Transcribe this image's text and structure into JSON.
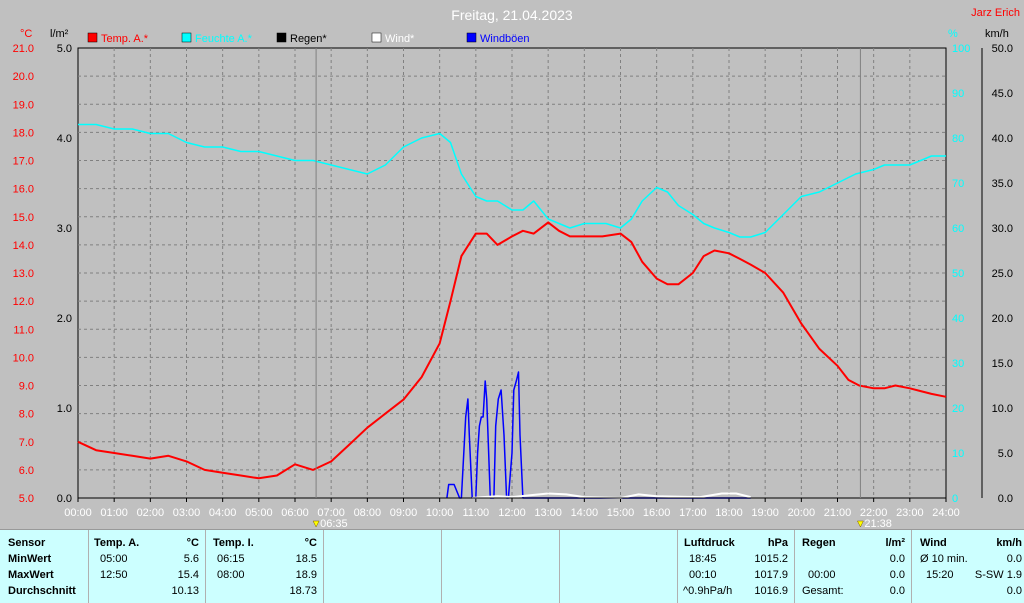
{
  "title": "Freitag, 21.04.2023",
  "author": "Jarz Erich",
  "units": {
    "left_temp": "°C",
    "left_rain": "l/m²",
    "right_hum": "%",
    "right_wind": "km/h"
  },
  "legend": [
    {
      "label": "Temp. A.*",
      "color": "#ff0000"
    },
    {
      "label": "Feuchte A.*",
      "color": "#00ffff"
    },
    {
      "label": "Regen*",
      "color": "#000000"
    },
    {
      "label": "Wind*",
      "color": "#ffffff"
    },
    {
      "label": "Windböen",
      "color": "#0000ff"
    }
  ],
  "sunrise": "06:35",
  "sunset": "21:38",
  "chart_data": {
    "type": "line",
    "title": "Freitag, 21.04.2023",
    "x_ticks": [
      "00:00",
      "01:00",
      "02:00",
      "03:00",
      "04:00",
      "05:00",
      "06:00",
      "07:00",
      "08:00",
      "09:00",
      "10:00",
      "11:00",
      "12:00",
      "13:00",
      "14:00",
      "15:00",
      "16:00",
      "17:00",
      "18:00",
      "19:00",
      "20:00",
      "21:00",
      "22:00",
      "23:00",
      "24:00"
    ],
    "axes": {
      "temp": {
        "ylim": [
          5.0,
          21.0
        ],
        "ticks": [
          "5.0",
          "6.0",
          "7.0",
          "8.0",
          "9.0",
          "10.0",
          "11.0",
          "12.0",
          "13.0",
          "14.0",
          "15.0",
          "16.0",
          "17.0",
          "18.0",
          "19.0",
          "20.0",
          "21.0"
        ]
      },
      "rain": {
        "ylim": [
          0.0,
          5.0
        ],
        "ticks": [
          "0.0",
          "1.0",
          "2.0",
          "3.0",
          "4.0",
          "5.0"
        ]
      },
      "humidity": {
        "ylim": [
          0,
          100
        ],
        "ticks": [
          "0",
          "10",
          "20",
          "30",
          "40",
          "50",
          "60",
          "70",
          "80",
          "90",
          "100"
        ]
      },
      "wind": {
        "ylim": [
          0.0,
          50.0
        ],
        "ticks": [
          "0.0",
          "5.0",
          "10.0",
          "15.0",
          "20.0",
          "25.0",
          "30.0",
          "35.0",
          "40.0",
          "45.0",
          "50.0"
        ]
      }
    },
    "series": [
      {
        "name": "Temp. A.*",
        "color": "#ff0000",
        "axis": "temp",
        "x": [
          0,
          0.5,
          1,
          1.5,
          2,
          2.5,
          3,
          3.5,
          4,
          4.5,
          5,
          5.5,
          6,
          6.5,
          7,
          7.5,
          8,
          8.5,
          9,
          9.5,
          10,
          10.3,
          10.6,
          11,
          11.3,
          11.6,
          12,
          12.3,
          12.6,
          13,
          13.3,
          13.6,
          14,
          14.5,
          15,
          15.3,
          15.6,
          16,
          16.3,
          16.6,
          17,
          17.3,
          17.6,
          18,
          18.3,
          18.6,
          19,
          19.5,
          20,
          20.5,
          21,
          21.3,
          21.6,
          22,
          22.3,
          22.6,
          23,
          23.3,
          23.6,
          24
        ],
        "y": [
          7.0,
          6.7,
          6.6,
          6.5,
          6.4,
          6.5,
          6.3,
          6.0,
          5.9,
          5.8,
          5.7,
          5.8,
          6.2,
          6.0,
          6.3,
          6.9,
          7.5,
          8.0,
          8.5,
          9.3,
          10.5,
          12.0,
          13.6,
          14.4,
          14.4,
          14.0,
          14.3,
          14.5,
          14.4,
          14.8,
          14.5,
          14.3,
          14.3,
          14.3,
          14.4,
          14.1,
          13.4,
          12.8,
          12.6,
          12.6,
          13.0,
          13.6,
          13.8,
          13.7,
          13.5,
          13.3,
          13.0,
          12.3,
          11.2,
          10.3,
          9.7,
          9.2,
          9.0,
          8.9,
          8.9,
          9.0,
          8.9,
          8.8,
          8.7,
          8.6
        ]
      },
      {
        "name": "Feuchte A.*",
        "color": "#00ffff",
        "axis": "humidity",
        "x": [
          0,
          0.5,
          1,
          1.5,
          2,
          2.5,
          3,
          3.5,
          4,
          4.5,
          5,
          5.5,
          6,
          6.5,
          7,
          7.5,
          8,
          8.5,
          9,
          9.5,
          10,
          10.3,
          10.6,
          11,
          11.3,
          11.6,
          12,
          12.3,
          12.6,
          13,
          13.3,
          13.6,
          14,
          14.3,
          14.6,
          15,
          15.3,
          15.6,
          16,
          16.3,
          16.6,
          17,
          17.3,
          17.6,
          18,
          18.3,
          18.6,
          19,
          19.5,
          20,
          20.5,
          21,
          21.5,
          22,
          22.3,
          22.6,
          23,
          23.3,
          23.6,
          24
        ],
        "y": [
          83,
          83,
          82,
          82,
          81,
          81,
          79,
          78,
          78,
          77,
          77,
          76,
          75,
          75,
          74,
          73,
          72,
          74,
          78,
          80,
          81,
          79,
          72,
          67,
          66,
          66,
          64,
          64,
          66,
          62,
          61,
          60,
          61,
          61,
          61,
          60,
          62,
          66,
          69,
          68,
          65,
          63,
          61,
          60,
          59,
          58,
          58,
          59,
          63,
          67,
          68,
          70,
          72,
          73,
          74,
          74,
          74,
          75,
          76,
          76
        ]
      },
      {
        "name": "Windböen",
        "color": "#0000ff",
        "axis": "wind",
        "x": [
          10.2,
          10.25,
          10.4,
          10.55,
          10.6,
          10.72,
          10.78,
          10.82,
          10.9,
          11.0,
          11.05,
          11.1,
          11.15,
          11.2,
          11.26,
          11.3,
          11.4,
          11.5,
          11.55,
          11.62,
          11.7,
          11.78,
          11.85,
          11.9,
          12.0,
          12.05,
          12.12,
          12.18,
          12.22,
          12.3,
          12.38,
          12.44,
          12.5,
          12.6,
          12.7,
          12.8,
          12.88,
          12.95,
          13.0,
          13.05,
          13.12,
          13.2,
          13.3,
          13.4,
          13.48,
          13.55,
          13.62,
          13.68,
          13.75,
          13.85,
          13.95,
          14.0,
          14.05,
          14.1,
          14.15,
          14.2,
          15.0,
          15.08,
          15.15,
          15.2,
          15.25,
          15.32,
          15.38,
          15.5,
          16.5,
          16.55,
          16.62,
          16.7,
          16.72,
          16.78,
          16.85,
          16.9,
          17.0,
          17.1,
          17.18,
          17.25,
          17.3,
          17.4,
          17.5,
          17.55,
          17.62,
          17.7,
          17.78,
          17.85,
          17.9,
          17.95,
          18.05,
          18.1,
          18.15,
          18.2,
          18.3,
          18.4,
          18.5,
          18.6
        ],
        "y": [
          0,
          1.5,
          1.5,
          0,
          0,
          9,
          11,
          7,
          0,
          0,
          5,
          8,
          9,
          9,
          13,
          11,
          0,
          0,
          8,
          11,
          12,
          7,
          0,
          0,
          5,
          12,
          13,
          14,
          7,
          0,
          0,
          0,
          0,
          0,
          0,
          0,
          0,
          0,
          0,
          0,
          0,
          0,
          0,
          0,
          0,
          0,
          0,
          0,
          0,
          0,
          0,
          0,
          0,
          0,
          0,
          0,
          0,
          0,
          0,
          0,
          0,
          0,
          0,
          0,
          0,
          0,
          0,
          0,
          0,
          0,
          0,
          0,
          0,
          0,
          0,
          0,
          0,
          0,
          0,
          0,
          0,
          0,
          0,
          0,
          0,
          0,
          0,
          0,
          0,
          0,
          0,
          0,
          0,
          0
        ]
      },
      {
        "name": "Wind*",
        "color": "#ffffff",
        "axis": "wind",
        "x": [
          10.9,
          11.2,
          11.6,
          12.0,
          12.5,
          13.0,
          13.5,
          14.0,
          15.0,
          15.5,
          16.0,
          17.2,
          17.8,
          18.2,
          18.6
        ],
        "y": [
          0,
          0.1,
          0.2,
          0.1,
          0.3,
          0.5,
          0.4,
          0.1,
          0,
          0.4,
          0.2,
          0.1,
          0.5,
          0.5,
          0.1
        ]
      },
      {
        "name": "Regen*",
        "color": "#000000",
        "axis": "rain",
        "x": [
          0,
          24
        ],
        "y": [
          0.0,
          0.0
        ]
      }
    ]
  },
  "table": {
    "col1": {
      "head": "Sensor",
      "rows": [
        "MinWert",
        "MaxWert",
        "Durchschnitt"
      ]
    },
    "col2": {
      "head": "Temp. A.",
      "unit": "°C",
      "rows": [
        [
          "05:00",
          "5.6"
        ],
        [
          "12:50",
          "15.4"
        ],
        [
          "",
          "10.13"
        ]
      ]
    },
    "col3": {
      "head": "Temp. I.",
      "unit": "°C",
      "rows": [
        [
          "06:15",
          "18.5"
        ],
        [
          "08:00",
          "18.9"
        ],
        [
          "",
          "18.73"
        ]
      ]
    },
    "col4": {
      "head": "Luftdruck",
      "unit": "hPa",
      "rows": [
        [
          "18:45",
          "1015.2"
        ],
        [
          "00:10",
          "1017.9"
        ],
        [
          "^0.9hPa/h",
          "1016.9"
        ]
      ]
    },
    "col5": {
      "head": "Regen",
      "unit": "l/m²",
      "rows": [
        [
          "",
          ""
        ],
        [
          "00:00",
          "0.0"
        ],
        [
          "Gesamt:",
          "0.0"
        ]
      ],
      "row0_value": "0.0"
    },
    "col6": {
      "head": "Wind",
      "unit": "km/h",
      "rows": [
        [
          "Ø 10 min.",
          "0.0"
        ],
        [
          "15:20",
          "S-SW 1.9"
        ],
        [
          "",
          "0.0"
        ]
      ]
    }
  }
}
